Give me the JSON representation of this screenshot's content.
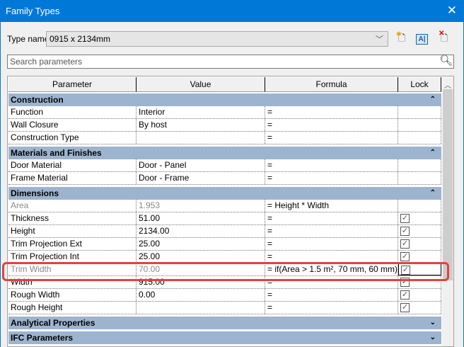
{
  "window": {
    "title": "Family Types",
    "close_icon": "close-icon"
  },
  "type_name": {
    "label": "Type name:",
    "value": "0915 x 2134mm"
  },
  "toolbar": {
    "new_type_icon": "new-type-icon",
    "rename_type_icon": "rename-type-icon",
    "delete_type_icon": "delete-type-icon"
  },
  "search": {
    "placeholder": "Search parameters"
  },
  "columns": [
    "Parameter",
    "Value",
    "Formula",
    "Lock"
  ],
  "highlight_color": "#e0443a",
  "groups": [
    {
      "name": "Construction",
      "expanded": true,
      "rows": [
        {
          "parameter": "Function",
          "value": "Interior",
          "formula": "=",
          "lock": null
        },
        {
          "parameter": "Wall Closure",
          "value": "By host",
          "formula": "=",
          "lock": null
        },
        {
          "parameter": "Construction Type",
          "value": "",
          "formula": "=",
          "lock": null
        }
      ]
    },
    {
      "name": "Materials and Finishes",
      "expanded": true,
      "rows": [
        {
          "parameter": "Door Material",
          "value": "Door - Panel",
          "formula": "=",
          "lock": null
        },
        {
          "parameter": "Frame Material",
          "value": "Door - Frame",
          "formula": "=",
          "lock": null
        }
      ]
    },
    {
      "name": "Dimensions",
      "expanded": true,
      "rows": [
        {
          "parameter": "Area",
          "value": "1.953",
          "formula": "= Height * Width",
          "lock": null,
          "disabled": true
        },
        {
          "parameter": "Thickness",
          "value": "51.00",
          "formula": "=",
          "lock": true
        },
        {
          "parameter": "Height",
          "value": "2134.00",
          "formula": "=",
          "lock": true
        },
        {
          "parameter": "Trim Projection Ext",
          "value": "25.00",
          "formula": "=",
          "lock": true
        },
        {
          "parameter": "Trim Projection Int",
          "value": "25.00",
          "formula": "=",
          "lock": true
        },
        {
          "parameter": "Trim Width",
          "value": "70.00",
          "formula": "= if(Area > 1.5 m², 70 mm, 60 mm)",
          "lock": true,
          "disabled": true,
          "highlighted": true
        },
        {
          "parameter": "Width",
          "value": "915.00",
          "formula": "=",
          "lock": true
        },
        {
          "parameter": "Rough Width",
          "value": "0.00",
          "formula": "=",
          "lock": true
        },
        {
          "parameter": "Rough Height",
          "value": "",
          "formula": "=",
          "lock": true
        }
      ]
    },
    {
      "name": "Analytical Properties",
      "expanded": false,
      "rows": []
    },
    {
      "name": "IFC Parameters",
      "expanded": false,
      "rows": []
    }
  ]
}
